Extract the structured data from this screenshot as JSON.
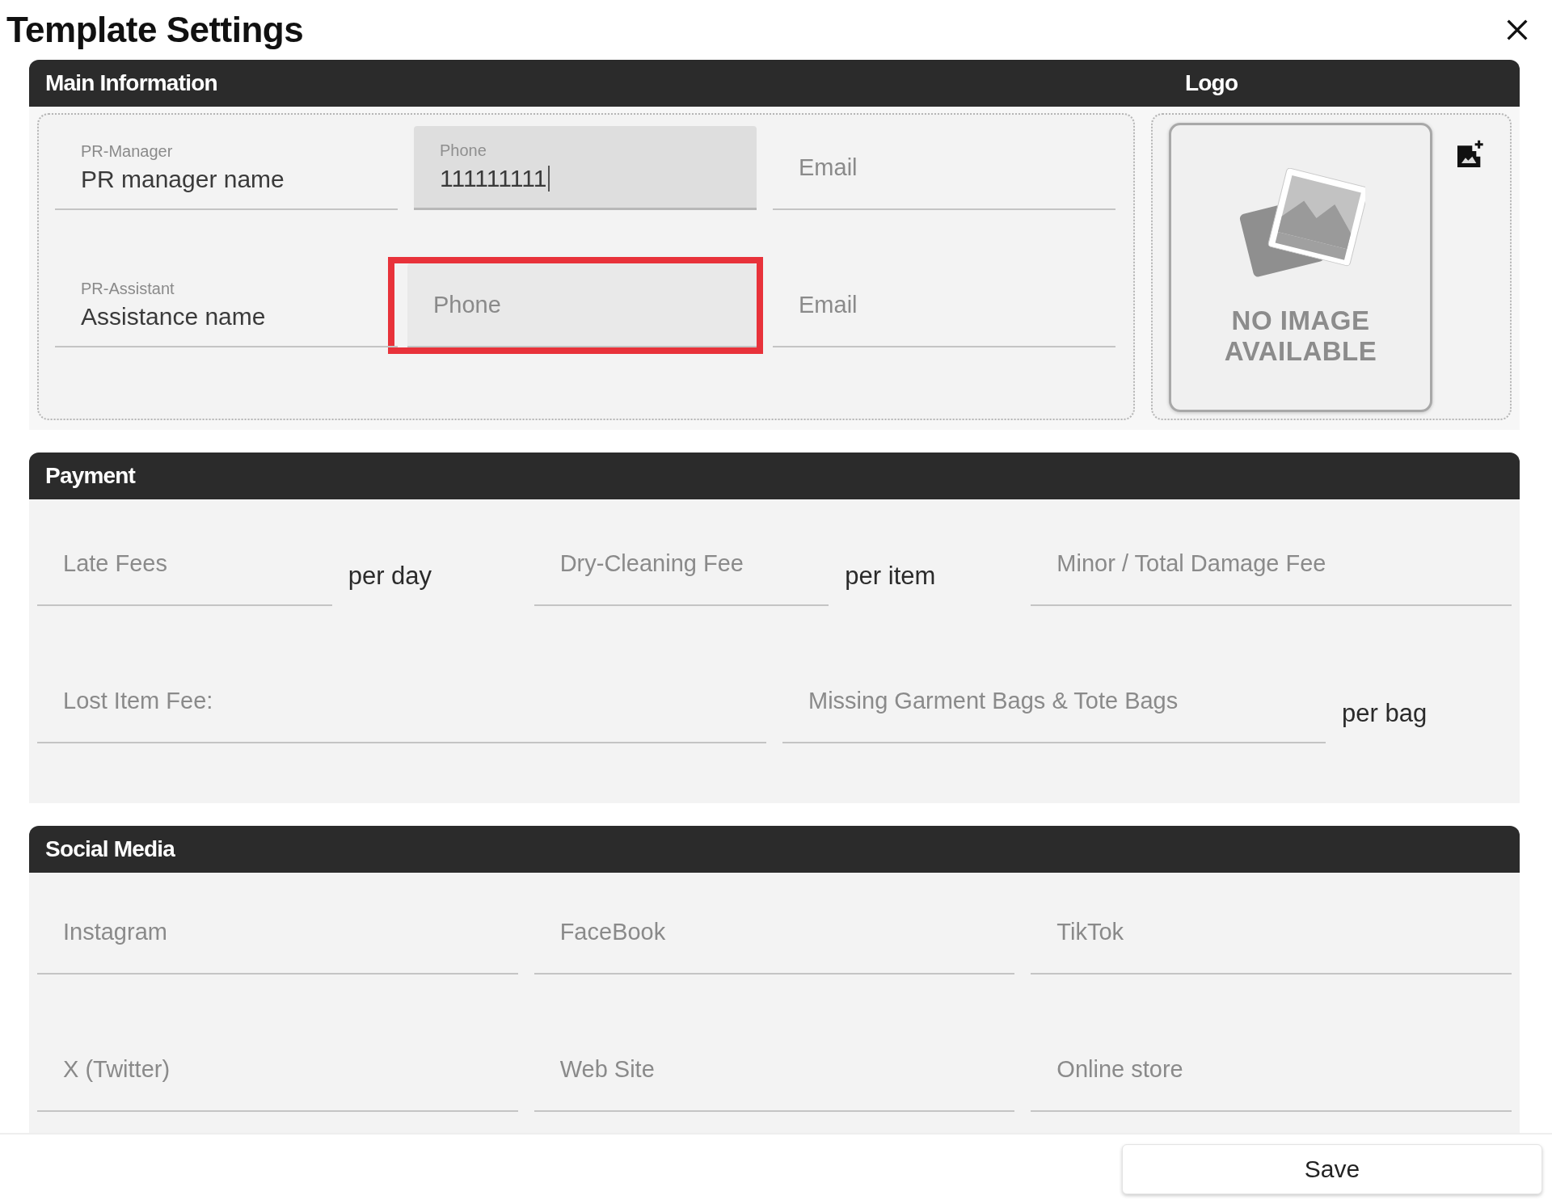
{
  "dialog": {
    "title": "Template Settings"
  },
  "main_information": {
    "title": "Main Information",
    "rows": [
      {
        "fields": [
          {
            "label": "PR-Manager",
            "value": "PR manager name",
            "filled": false,
            "focused": false,
            "highlighted": false
          },
          {
            "label": "Phone",
            "value": "111111111",
            "filled": true,
            "focused": true,
            "highlighted": false
          },
          {
            "placeholder": "Email",
            "filled": false,
            "focused": false,
            "highlighted": false
          }
        ]
      },
      {
        "fields": [
          {
            "label": "PR-Assistant",
            "value": "Assistance name",
            "filled": false,
            "focused": false,
            "highlighted": false
          },
          {
            "placeholder": "Phone",
            "filled": true,
            "focused": false,
            "highlighted": true
          },
          {
            "placeholder": "Email",
            "filled": false,
            "focused": false,
            "highlighted": false
          }
        ]
      }
    ]
  },
  "logo": {
    "title": "Logo",
    "image_text": "NO IMAGE AVAILABLE"
  },
  "payment": {
    "title": "Payment",
    "rows": [
      {
        "groups": [
          {
            "placeholder": "Late Fees",
            "suffix": "per day"
          },
          {
            "placeholder": "Dry-Cleaning Fee",
            "suffix": "per item"
          },
          {
            "placeholder": "Minor / Total Damage Fee"
          }
        ]
      },
      {
        "groups": [
          {
            "placeholder": "Lost Item Fee:"
          },
          {
            "placeholder": "Missing Garment Bags & Tote Bags",
            "suffix": "per bag"
          }
        ]
      }
    ]
  },
  "social_media": {
    "title": "Social Media",
    "fields": [
      {
        "placeholder": "Instagram"
      },
      {
        "placeholder": "FaceBook"
      },
      {
        "placeholder": "TikTok"
      },
      {
        "placeholder": "X (Twitter)"
      },
      {
        "placeholder": "Web Site"
      },
      {
        "placeholder": "Online store"
      }
    ]
  },
  "footer": {
    "save_button": "Save"
  }
}
